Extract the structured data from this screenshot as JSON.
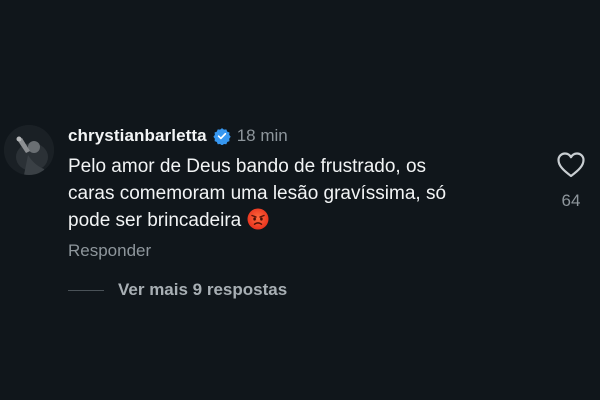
{
  "comment": {
    "username": "chrystianbarletta",
    "verified": true,
    "time": "18 min",
    "text_lines": [
      "Pelo amor de Deus bando de frustrado, os",
      "caras comemoram uma lesão gravíssima, só",
      "pode ser brincadeira"
    ],
    "emoji": "angry-face-icon",
    "reply_label": "Responder",
    "like_count": "64",
    "more_replies_label": "Ver mais 9 respostas"
  },
  "colors": {
    "background": "#10161b",
    "primary_text": "#f2f4f5",
    "secondary_text": "#8e969c",
    "verified_badge": "#3797f0"
  },
  "icons": {
    "like": "heart-outline-icon",
    "verified": "verified-badge-icon"
  }
}
